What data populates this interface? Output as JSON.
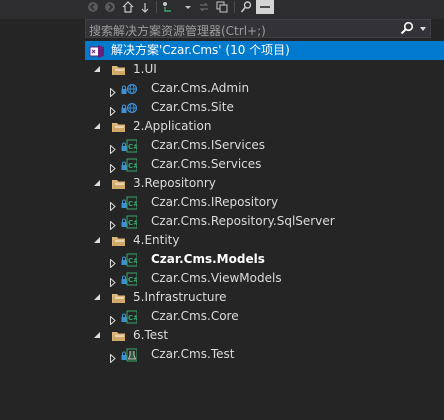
{
  "search": {
    "placeholder": "搜索解决方案资源管理器(Ctrl+;)"
  },
  "colors": {
    "background": "#252526",
    "selected": "#007acc",
    "text": "#dcdcdc",
    "folder": "#dcb67a",
    "csharp": "#39a86b",
    "web": "#3d8fd6"
  },
  "tree": {
    "solution": {
      "label": "解决方案'Czar.Cms' (10 个项目)",
      "icon": "solution-icon"
    },
    "folders": [
      {
        "label": "1.UI",
        "projects": [
          {
            "label": "Czar.Cms.Admin",
            "icon": "web-project-icon",
            "bold": false
          },
          {
            "label": "Czar.Cms.Site",
            "icon": "web-project-icon",
            "bold": false
          }
        ]
      },
      {
        "label": "2.Application",
        "projects": [
          {
            "label": "Czar.Cms.IServices",
            "icon": "csharp-project-icon",
            "bold": false
          },
          {
            "label": "Czar.Cms.Services",
            "icon": "csharp-project-icon",
            "bold": false
          }
        ]
      },
      {
        "label": "3.Repositonry",
        "projects": [
          {
            "label": "Czar.Cms.IRepository",
            "icon": "csharp-project-icon",
            "bold": false
          },
          {
            "label": "Czar.Cms.Repository.SqlServer",
            "icon": "csharp-project-icon",
            "bold": false
          }
        ]
      },
      {
        "label": "4.Entity",
        "projects": [
          {
            "label": "Czar.Cms.Models",
            "icon": "csharp-project-icon",
            "bold": true
          },
          {
            "label": "Czar.Cms.ViewModels",
            "icon": "csharp-project-icon",
            "bold": false
          }
        ]
      },
      {
        "label": "5.Infrastructure",
        "projects": [
          {
            "label": "Czar.Cms.Core",
            "icon": "csharp-project-icon",
            "bold": false
          }
        ]
      },
      {
        "label": "6.Test",
        "projects": [
          {
            "label": "Czar.Cms.Test",
            "icon": "test-project-icon",
            "bold": false
          }
        ]
      }
    ]
  }
}
